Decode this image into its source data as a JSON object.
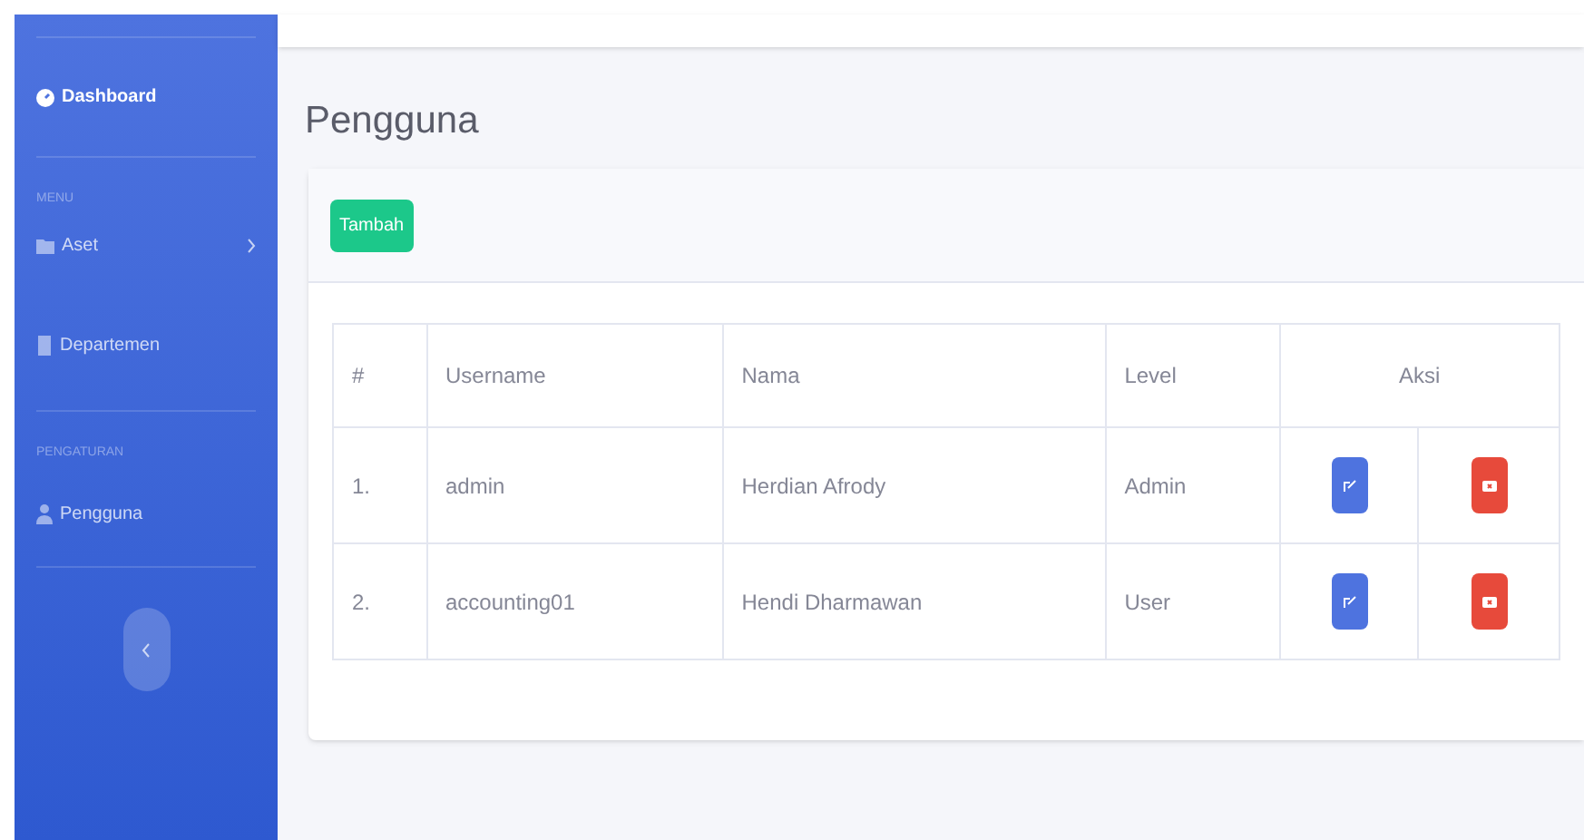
{
  "sidebar": {
    "items": [
      {
        "kind": "link",
        "label": "Dashboard",
        "selected": true
      },
      {
        "kind": "heading",
        "label": "MENU"
      },
      {
        "kind": "link",
        "label": "Aset",
        "selected": false,
        "expandable": true
      },
      {
        "kind": "link",
        "label": "Departemen",
        "selected": false
      },
      {
        "kind": "heading",
        "label": "PENGATURAN"
      },
      {
        "kind": "link",
        "label": "Pengguna",
        "selected": false
      }
    ]
  },
  "page_title": "Pengguna",
  "add_button": "Tambah",
  "table": {
    "columns": [
      "#",
      "Username",
      "Nama",
      "Level",
      "Aksi"
    ],
    "rows": [
      {
        "number": "1.",
        "username": "admin",
        "name": "Herdian Afrody",
        "level_text": "Admin"
      },
      {
        "number": "2.",
        "username": "accounting01",
        "name": "Hendi Dharmawan",
        "level_text": "User"
      }
    ]
  }
}
